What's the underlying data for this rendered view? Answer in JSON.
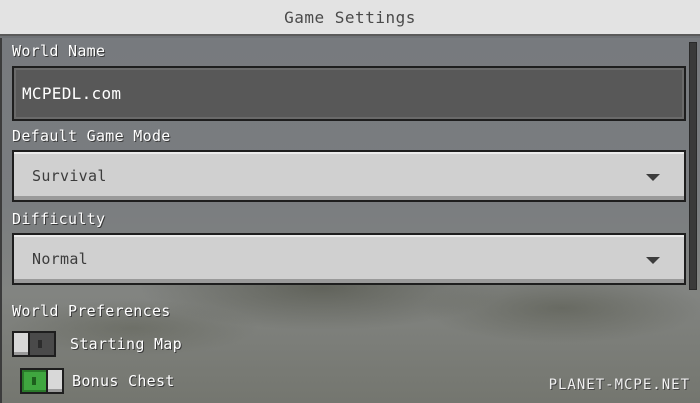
{
  "header": {
    "title": "Game Settings"
  },
  "world_name": {
    "label": "World Name",
    "value": "MCPEDL.com"
  },
  "game_mode": {
    "label": "Default Game Mode",
    "selected": "Survival"
  },
  "difficulty": {
    "label": "Difficulty",
    "selected": "Normal"
  },
  "preferences": {
    "heading": "World Preferences",
    "toggles": [
      {
        "label": "Starting Map",
        "state": "off"
      },
      {
        "label": "Bonus Chest",
        "state": "on"
      }
    ]
  },
  "watermark": "PLANET-MCPE.NET",
  "colors": {
    "toggle_on": "#3fa63f",
    "title_bar": "#e3e3e3",
    "field_bg": "#585858",
    "dropdown_bg": "#d0d0d0"
  },
  "icons": {
    "dropdown": "chevron-down-icon"
  }
}
